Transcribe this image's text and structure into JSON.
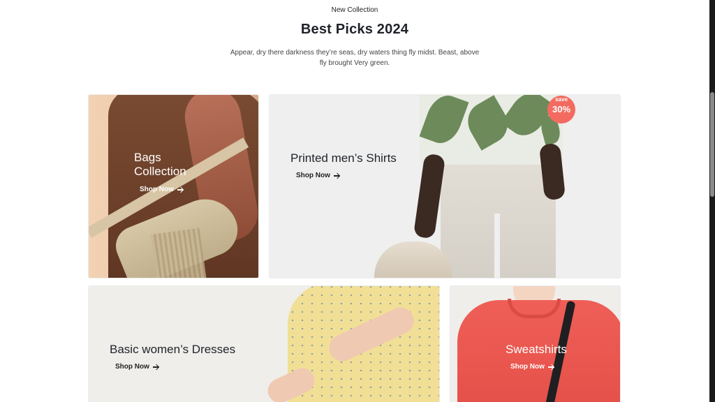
{
  "header": {
    "eyebrow": "New Collection",
    "title": "Best Picks 2024",
    "description": "Appear, dry there darkness they’re seas, dry waters thing fly midst. Beast, above fly brought Very green."
  },
  "cards": [
    {
      "label": "Bags Collection",
      "label_line1": "Bags",
      "label_line2": "Collection",
      "cta": "Shop Now"
    },
    {
      "label": "Printed men’s Shirts",
      "cta": "Shop Now",
      "badge_top": "save",
      "badge_value": "30%"
    },
    {
      "label": "Basic women’s Dresses",
      "cta": "Shop Now"
    },
    {
      "label": "Sweatshirts",
      "cta": "Shop Now"
    }
  ],
  "colors": {
    "badge": "#f36b60",
    "title": "#1f2329"
  }
}
